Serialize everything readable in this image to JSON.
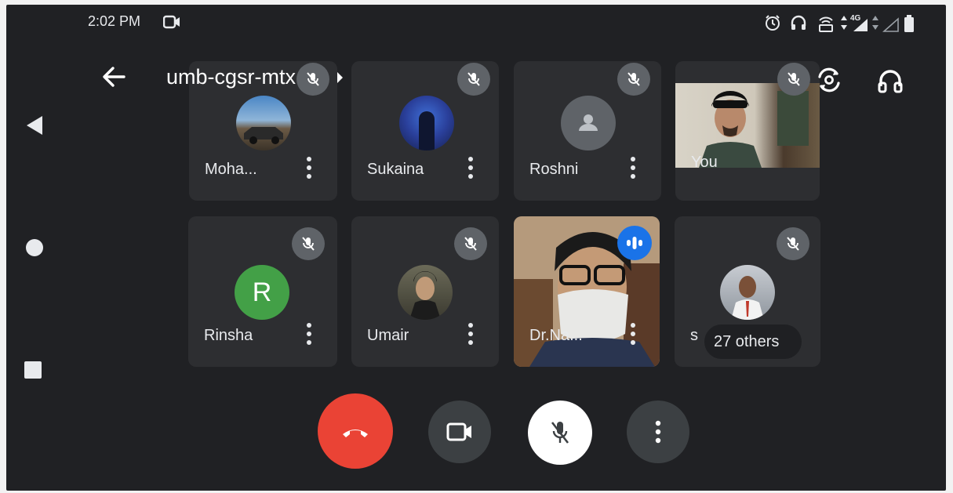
{
  "status_bar": {
    "time": "2:02 PM",
    "network": "4G",
    "icons": [
      "video-record-icon",
      "alarm-icon",
      "headset-icon",
      "hotspot-icon",
      "signal-icon",
      "battery-icon"
    ]
  },
  "header": {
    "meeting_code": "umb-cgsr-mtx",
    "icons": [
      "back-arrow-icon",
      "chevron-right-icon",
      "switch-camera-icon",
      "headset-icon"
    ]
  },
  "participants": [
    {
      "name": "Moha...",
      "muted": true,
      "avatar": "photo"
    },
    {
      "name": "Sukaina",
      "muted": true,
      "avatar": "photo"
    },
    {
      "name": "Roshni",
      "muted": true,
      "avatar": "default-person"
    },
    {
      "name": "You",
      "muted": true,
      "avatar": "video"
    },
    {
      "name": "Rinsha",
      "muted": true,
      "avatar": "initial",
      "initial": "R",
      "avatar_color": "#43a047"
    },
    {
      "name": "Umair",
      "muted": true,
      "avatar": "photo"
    },
    {
      "name": "Dr.Na...",
      "muted": false,
      "speaking": true,
      "avatar": "video"
    },
    {
      "name": "s",
      "muted": true,
      "avatar": "photo",
      "others_label": "27 others"
    }
  ],
  "controls": {
    "end_call_color": "#ea4335",
    "mic_button_color": "#ffffff",
    "icons": [
      "end-call-icon",
      "camera-icon",
      "mic-off-icon",
      "more-options-icon"
    ]
  },
  "system_nav": [
    "back-triangle-icon",
    "home-circle-icon",
    "recents-square-icon"
  ]
}
